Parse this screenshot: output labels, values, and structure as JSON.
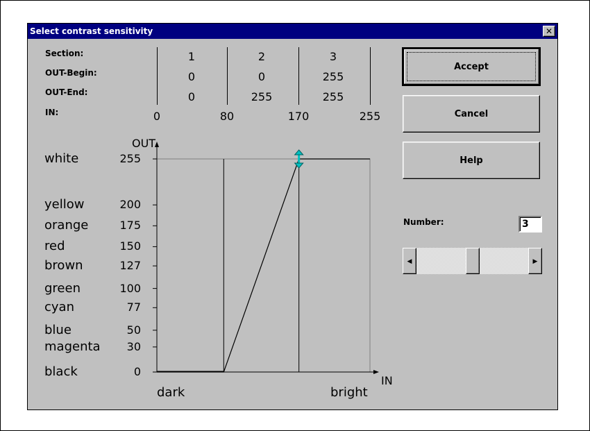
{
  "dialog": {
    "title": "Select contrast sensitivity",
    "close_label": "✕"
  },
  "table": {
    "row_labels": {
      "section": "Section:",
      "out_begin": "OUT-Begin:",
      "out_end": "OUT-End:",
      "in": "IN:"
    },
    "sections": [
      "1",
      "2",
      "3"
    ],
    "out_begin": [
      "0",
      "0",
      "255"
    ],
    "out_end": [
      "0",
      "255",
      "255"
    ],
    "in_boundaries": [
      "0",
      "80",
      "170",
      "255"
    ]
  },
  "graph": {
    "y_axis_label": "OUT",
    "x_axis_label": "IN",
    "x_left_label": "dark",
    "x_right_label": "bright",
    "levels": [
      {
        "name": "white",
        "value": "255"
      },
      {
        "name": "yellow",
        "value": "200"
      },
      {
        "name": "orange",
        "value": "175"
      },
      {
        "name": "red",
        "value": "150"
      },
      {
        "name": "brown",
        "value": "127"
      },
      {
        "name": "green",
        "value": "100"
      },
      {
        "name": "cyan",
        "value": "77"
      },
      {
        "name": "blue",
        "value": "50"
      },
      {
        "name": "magenta",
        "value": "30"
      },
      {
        "name": "black",
        "value": "0"
      }
    ],
    "x_range": [
      0,
      255
    ],
    "y_range": [
      0,
      255
    ],
    "section_boundaries": [
      80,
      170
    ],
    "curve_points": [
      [
        0,
        0
      ],
      [
        80,
        0
      ],
      [
        170,
        255
      ],
      [
        255,
        255
      ]
    ],
    "handle_point": [
      170,
      255
    ],
    "handle_color": "#00c0c0"
  },
  "buttons": {
    "accept": "Accept",
    "cancel": "Cancel",
    "help": "Help"
  },
  "number": {
    "label": "Number:",
    "value": "3",
    "slider_fraction": 0.5
  },
  "colors": {
    "title_bar": "#000080",
    "face": "#c0c0c0"
  }
}
